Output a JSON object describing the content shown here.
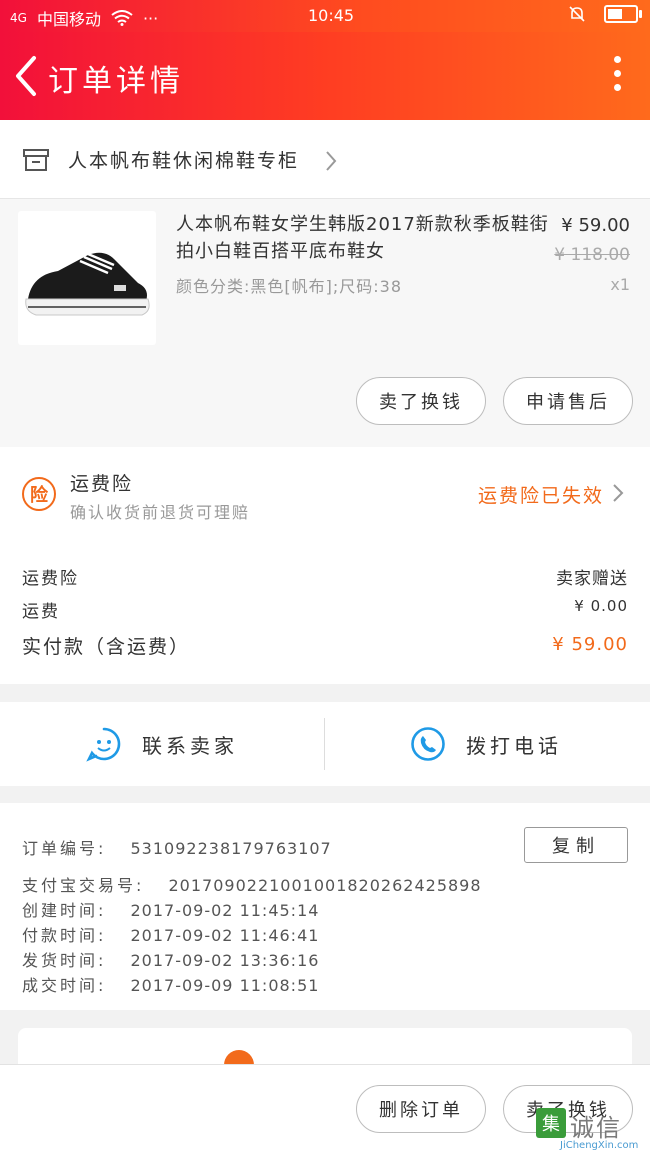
{
  "statusbar": {
    "signal": "4G",
    "carrier": "中国移动",
    "dots": "···",
    "time": "10:45"
  },
  "header": {
    "title": "订单详情",
    "gradient_colors": [
      "#f2103a",
      "#ff6a1c"
    ]
  },
  "shop": {
    "name": "人本帆布鞋休闲棉鞋专柜"
  },
  "product": {
    "title": "人本帆布鞋女学生韩版2017新款秋季板鞋街拍小白鞋百搭平底布鞋女",
    "sku": "颜色分类:黑色[帆布];尺码:38",
    "price": "¥ 59.00",
    "original_price": "¥ 118.00",
    "quantity": "x1",
    "btn_sell": "卖了换钱",
    "btn_aftersale": "申请售后"
  },
  "insurance": {
    "icon_char": "险",
    "title": "运费险",
    "subtitle": "确认收货前退货可理赔",
    "status": "运费险已失效",
    "accent": "#f26a1b"
  },
  "fees": {
    "rows": [
      {
        "label": "运费险",
        "value": "卖家赠送"
      },
      {
        "label": "运费",
        "value": "¥ 0.00"
      }
    ],
    "total_label": "实付款（含运费）",
    "total_value": "¥ 59.00"
  },
  "contact": {
    "seller": "联系卖家",
    "call": "拨打电话",
    "icon_color": "#1f9ae6"
  },
  "order_info": {
    "copy": "复制",
    "rows": [
      {
        "k": "订单编号:",
        "v": "531092238179763107"
      },
      {
        "k": "支付宝交易号:",
        "v": "2017090221001001820262425898"
      },
      {
        "k": "创建时间:",
        "v": "2017-09-02 11:45:14"
      },
      {
        "k": "付款时间:",
        "v": "2017-09-02 11:46:41"
      },
      {
        "k": "发货时间:",
        "v": "2017-09-02 13:36:16"
      },
      {
        "k": "成交时间:",
        "v": "2017-09-09 11:08:51"
      }
    ]
  },
  "bottom": {
    "delete": "删除订单",
    "sell": "卖了换钱"
  },
  "watermark": {
    "logo": "集",
    "text": "诚信",
    "url": "JiChengXin.com"
  }
}
